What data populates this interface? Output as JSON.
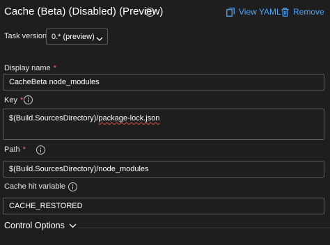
{
  "header": {
    "title": "Cache (Beta) (Disabled) (Preview)",
    "view_yaml_label": "View YAML",
    "remove_label": "Remove"
  },
  "task_version": {
    "label": "Task version",
    "selected": "0.* (preview)"
  },
  "fields": {
    "display_name": {
      "label": "Display name",
      "value": "CacheBeta node_modules",
      "required": true
    },
    "key": {
      "label": "Key",
      "value_prefix": "$(Build.SourcesDirectory)/",
      "value_flagged": "package-lock.json",
      "required": true
    },
    "path": {
      "label": "Path",
      "value": "$(Build.SourcesDirectory)/node_modules",
      "required": true
    },
    "cache_hit_variable": {
      "label": "Cache hit variable",
      "value": "CACHE_RESTORED",
      "required": false
    }
  },
  "control_options": {
    "label": "Control Options"
  },
  "required_marker": "*",
  "colors": {
    "background": "#1e1e1e",
    "accent_link": "#4fa3f7",
    "required": "#f1707b",
    "border": "#5c5c5c",
    "spellcheck_underline": "#e04e4e"
  },
  "icons": [
    "info-icon",
    "view-yaml-icon",
    "trash-icon",
    "chevron-down-icon"
  ]
}
